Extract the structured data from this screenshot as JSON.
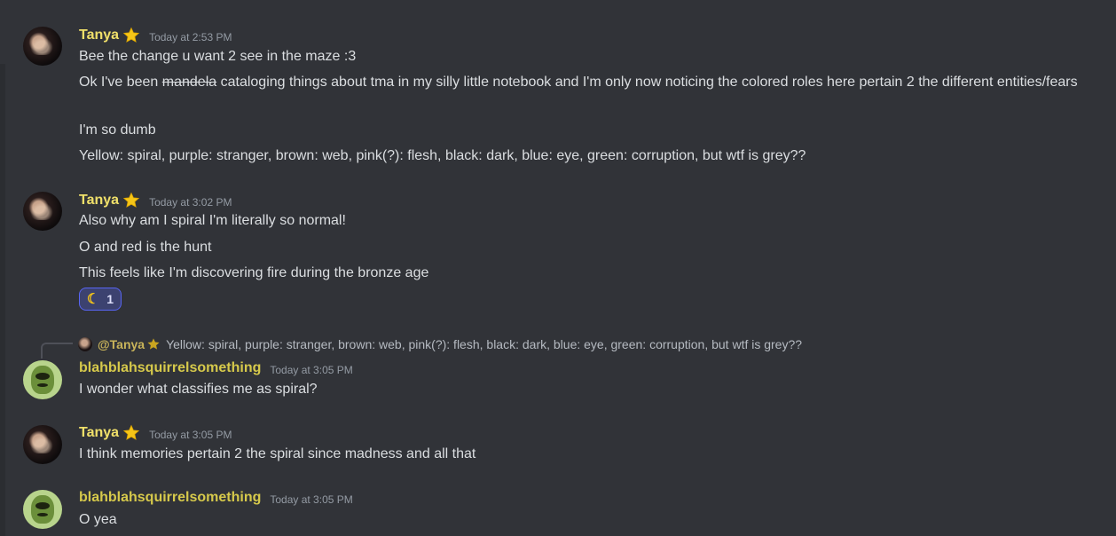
{
  "messages": {
    "m1": {
      "username": "Tanya",
      "timestamp": "Today at 2:53 PM",
      "lines": [
        "Bee the change u want 2 see in the maze :3",
        "cataloging things about tma in my silly little notebook and I'm only now noticing the colored roles here pertain 2 the different entities/fears",
        "I'm so dumb",
        "Yellow: spiral, purple: stranger, brown: web, pink(?): flesh, black: dark, blue: eye, green: corruption, but wtf is grey??"
      ],
      "line2_prefix": "Ok I've been",
      "line2_struck": "mandela"
    },
    "m2": {
      "username": "Tanya",
      "timestamp": "Today at 3:02 PM",
      "lines": [
        "Also why am I spiral I'm literally so normal!",
        "O and red is the hunt",
        "This feels like I'm discovering fire during the bronze age"
      ],
      "reaction": {
        "emoji": "☾",
        "count": "1"
      }
    },
    "m3": {
      "reply": {
        "mention": "@Tanya",
        "text": "Yellow: spiral, purple: stranger, brown: web, pink(?): flesh, black: dark, blue: eye, green: corruption, but wtf is grey??"
      },
      "username": "blahblahsquirrelsomething",
      "timestamp": "Today at 3:05 PM",
      "lines": [
        "I wonder what classifies me as spiral?"
      ]
    },
    "m4": {
      "username": "Tanya",
      "timestamp": "Today at 3:05 PM",
      "lines": [
        "I think memories pertain 2 the spiral since madness and all that"
      ]
    },
    "m5": {
      "username": "blahblahsquirrelsomething",
      "timestamp": "Today at 3:05 PM",
      "lines": [
        "O yea"
      ]
    }
  },
  "colors": {
    "background": "#313338",
    "username_tanya": "#f0e06a",
    "username_squirrel": "#d6c94b",
    "reaction_border": "#5865f2"
  },
  "icons": {
    "role_badge": "star-icon",
    "reaction_emoji": "crescent-moon-icon"
  }
}
